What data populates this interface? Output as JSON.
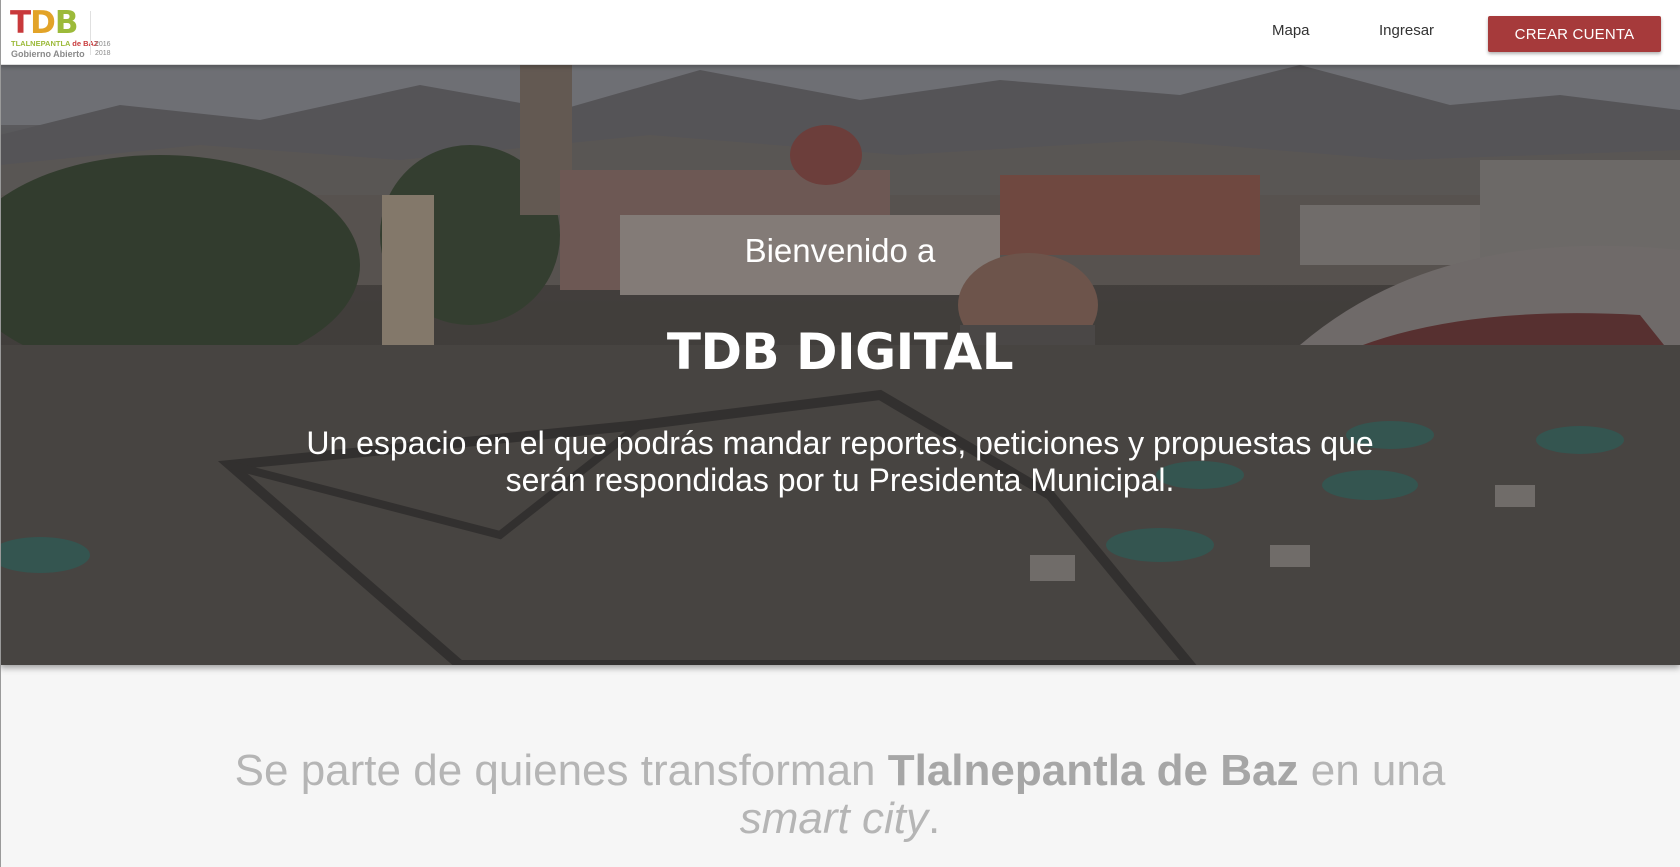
{
  "header": {
    "logo": {
      "mark_t": "T",
      "mark_d": "D",
      "mark_b": "B",
      "line1_a": "TLALNEPANTLA",
      "line1_b": "de BAZ",
      "line2": "Gobierno Abierto",
      "year_start": "2016",
      "year_end": "2018"
    },
    "nav": {
      "mapa": "Mapa",
      "ingresar": "Ingresar",
      "crear_cuenta": "CREAR CUENTA"
    }
  },
  "hero": {
    "welcome": "Bienvenido a",
    "title": "TDB DIGITAL",
    "description": "Un espacio en el que podrás mandar reportes, peticiones y propuestas que serán respondidas por tu Presidenta Municipal."
  },
  "tagline": {
    "part1": "Se parte de quienes transforman ",
    "bold": "Tlalnepantla de Baz",
    "part2": " en una ",
    "italic": "smart city",
    "end": "."
  },
  "colors": {
    "accent": "#a63a3b",
    "logo_red": "#c8393b",
    "logo_yellow": "#e2a328",
    "logo_green": "#9cba3a",
    "tagline": "#b5b5b5"
  }
}
